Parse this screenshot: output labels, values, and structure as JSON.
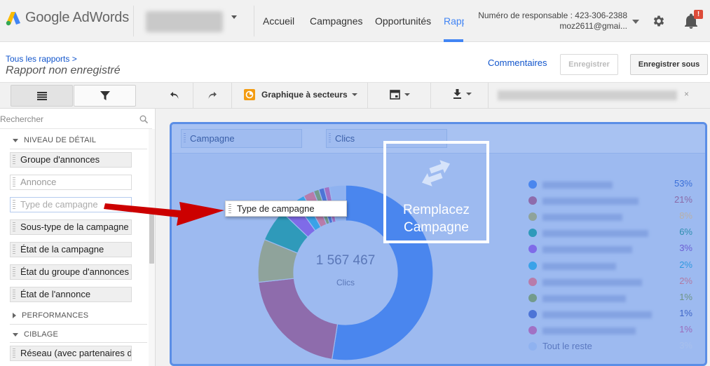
{
  "app": {
    "logo_text": "Google AdWords"
  },
  "nav": {
    "items": [
      "Accueil",
      "Campagnes",
      "Opportunités",
      "Rapp"
    ],
    "responsible_label": "Numéro de responsable : 423-306-2388",
    "email": "moz2611@gmai..."
  },
  "badge": "!",
  "subheader": {
    "breadcrumb": "Tous les rapports >",
    "title": "Rapport non enregistré",
    "comments": "Commentaires",
    "save": "Enregistrer",
    "save_as": "Enregistrer sous"
  },
  "left": {
    "search_placeholder": "Rechercher",
    "section_detail": "NIVEAU DE DÉTAIL",
    "detail_items": [
      "Groupe d'annonces",
      "Annonce",
      "Type de campagne",
      "Sous-type de la campagne",
      "État de la campagne",
      "État du groupe d'annonces",
      "État de l'annonce"
    ],
    "section_perf": "PERFORMANCES",
    "section_target": "CIBLAGE",
    "target_items": [
      "Réseau (avec partenaires d"
    ]
  },
  "toolbar": {
    "chart_type": "Graphique à secteurs",
    "close": "×"
  },
  "dropzones": [
    "Campagne",
    "Clics"
  ],
  "drag_chip": "Type de campagne",
  "replace": {
    "line1": "Remplacez",
    "line2": "Campagne"
  },
  "chart_data": {
    "type": "pie",
    "title": "",
    "total_value": "1 567 467",
    "total_label": "Clics",
    "categories": [
      "",
      "",
      "",
      "",
      "",
      "",
      "",
      "",
      "",
      "",
      "Tout le reste"
    ],
    "values": [
      53,
      21,
      8,
      6,
      3,
      2,
      2,
      1,
      1,
      1,
      3
    ],
    "labels": [
      "53%",
      "21%",
      "8%",
      "6%",
      "3%",
      "2%",
      "2%",
      "1%",
      "1%",
      "1%",
      "3%"
    ],
    "colors": [
      "#4a86ee",
      "#8e6cac",
      "#8fa39b",
      "#2f9aba",
      "#7f6be8",
      "#3aa2e8",
      "#b87caa",
      "#739b8c",
      "#4d74d6",
      "#a171c4",
      "#8fb2f0"
    ],
    "pct_colors": [
      "#3a6fd8",
      "#8a6aa8",
      "#b8b0a8",
      "#2e8eb0",
      "#6b5ed4",
      "#2f98e0",
      "#b07aa4",
      "#6e9486",
      "#3e65c8",
      "#9a6cbc",
      "#a8c0ec"
    ]
  }
}
